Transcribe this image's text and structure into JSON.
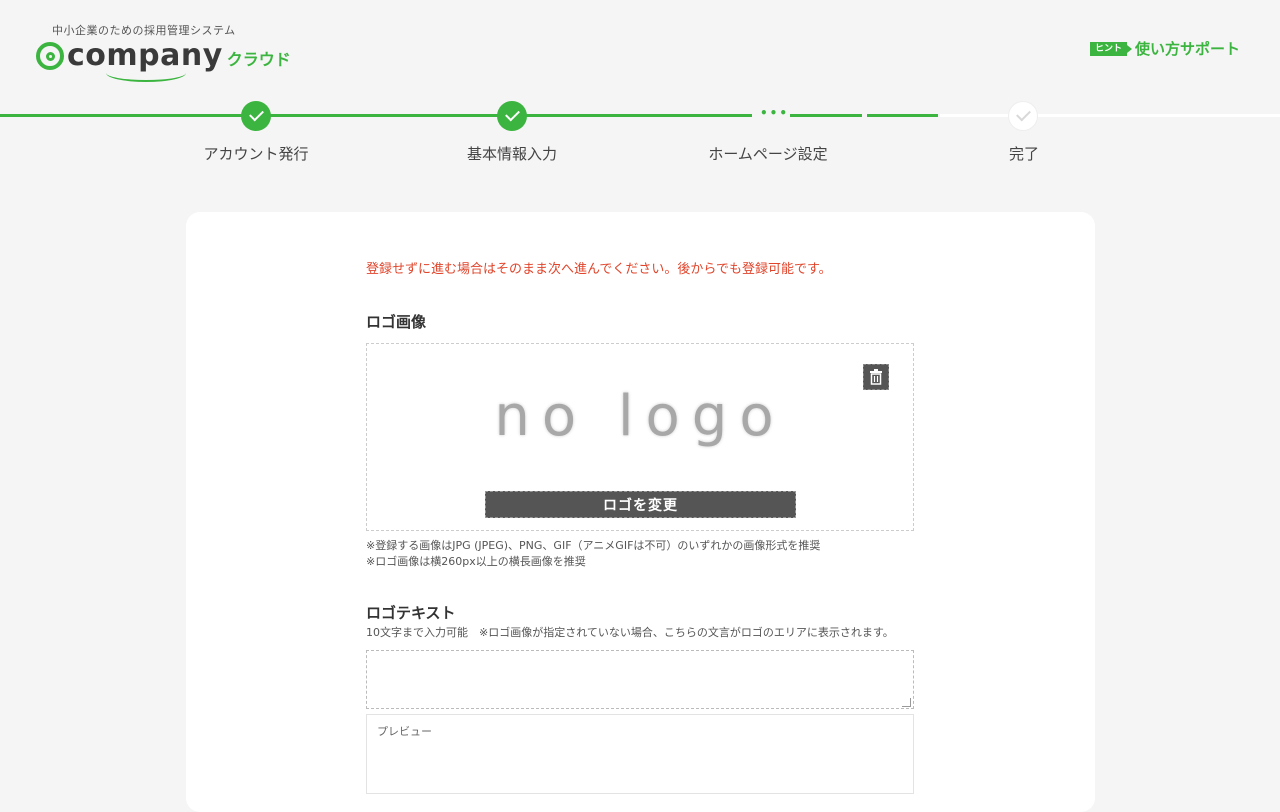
{
  "header": {
    "tagline": "中小企業のための採用管理システム",
    "brand": "company",
    "brand_sub": "クラウド",
    "help_badge": "ヒント",
    "help_label": "使い方サポート"
  },
  "steps": [
    {
      "label": "アカウント発行",
      "status": "done"
    },
    {
      "label": "基本情報入力",
      "status": "done"
    },
    {
      "label": "ホームページ設定",
      "status": "current"
    },
    {
      "label": "完了",
      "status": "todo"
    }
  ],
  "form": {
    "notice": "登録せずに進む場合はそのまま次へ進んでください。後からでも登録可能です。",
    "logo_image": {
      "title": "ロゴ画像",
      "placeholder_text": "no logo",
      "change_button": "ロゴを変更",
      "note1": "※登録する画像はJPG (JPEG)、PNG、GIF（アニメGIFは不可）のいずれかの画像形式を推奨",
      "note2": "※ロゴ画像は横260px以上の横長画像を推奨"
    },
    "logo_text": {
      "title": "ロゴテキスト",
      "description": "10文字まで入力可能　※ロゴ画像が指定されていない場合、こちらの文言がロゴのエリアに表示されます。",
      "value": "",
      "preview_label": "プレビュー"
    }
  },
  "colors": {
    "accent": "#3cb540",
    "warning": "#e0452b",
    "button_dark": "#555555"
  }
}
